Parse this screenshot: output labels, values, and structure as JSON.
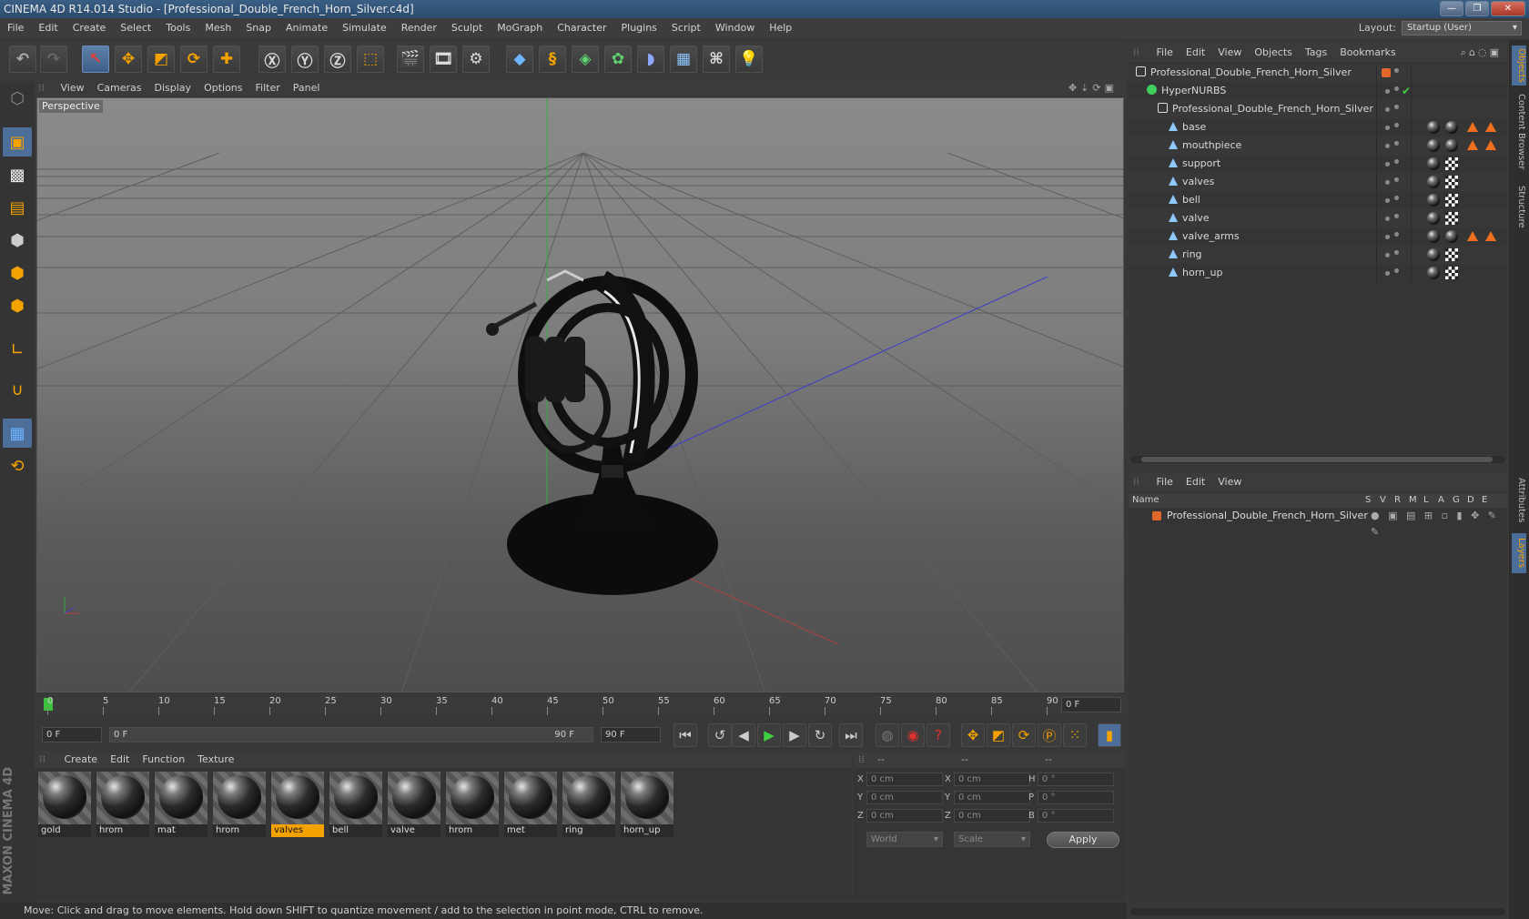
{
  "window": {
    "title": "CINEMA 4D R14.014 Studio - [Professional_Double_French_Horn_Silver.c4d]"
  },
  "menubar": {
    "items": [
      "File",
      "Edit",
      "Create",
      "Select",
      "Tools",
      "Mesh",
      "Snap",
      "Animate",
      "Simulate",
      "Render",
      "Sculpt",
      "MoGraph",
      "Character",
      "Plugins",
      "Script",
      "Window",
      "Help"
    ],
    "layout_label": "Layout:",
    "layout_value": "Startup (User)"
  },
  "viewport": {
    "menu": [
      "View",
      "Cameras",
      "Display",
      "Options",
      "Filter",
      "Panel"
    ],
    "label": "Perspective"
  },
  "timeline": {
    "ticks": [
      "0",
      "5",
      "10",
      "15",
      "20",
      "25",
      "30",
      "35",
      "40",
      "45",
      "50",
      "55",
      "60",
      "65",
      "70",
      "75",
      "80",
      "85",
      "90"
    ],
    "frame_right": "0 F"
  },
  "transport": {
    "start_frame": "0 F",
    "slider_left": "0 F",
    "slider_right": "90 F",
    "end_frame": "90 F"
  },
  "materials": {
    "menu": [
      "Create",
      "Edit",
      "Function",
      "Texture"
    ],
    "items": [
      {
        "name": "gold",
        "selected": false
      },
      {
        "name": "hrom",
        "selected": false
      },
      {
        "name": "mat",
        "selected": false
      },
      {
        "name": "hrom",
        "selected": false
      },
      {
        "name": "valves",
        "selected": true
      },
      {
        "name": "bell",
        "selected": false
      },
      {
        "name": "valve",
        "selected": false
      },
      {
        "name": "hrom",
        "selected": false
      },
      {
        "name": "met",
        "selected": false
      },
      {
        "name": "ring",
        "selected": false
      },
      {
        "name": "horn_up",
        "selected": false
      }
    ]
  },
  "coordinates": {
    "header": [
      "--",
      "--",
      "--"
    ],
    "rows": [
      {
        "l1": "X",
        "v1": "0 cm",
        "l2": "X",
        "v2": "0 cm",
        "l3": "H",
        "v3": "0 °"
      },
      {
        "l1": "Y",
        "v1": "0 cm",
        "l2": "Y",
        "v2": "0 cm",
        "l3": "P",
        "v3": "0 °"
      },
      {
        "l1": "Z",
        "v1": "0 cm",
        "l2": "Z",
        "v2": "0 cm",
        "l3": "B",
        "v3": "0 °"
      }
    ],
    "mode1": "World",
    "mode2": "Scale",
    "apply": "Apply"
  },
  "status": {
    "text": "Move: Click and drag to move elements. Hold down SHIFT to quantize movement / add to the selection in point mode, CTRL to remove."
  },
  "objects": {
    "menu": [
      "File",
      "Edit",
      "View",
      "Objects",
      "Tags",
      "Bookmarks"
    ],
    "rows": [
      {
        "name": "Professional_Double_French_Horn_Silver",
        "kind": "null",
        "indent": 0
      },
      {
        "name": "HyperNURBS",
        "kind": "nurbs",
        "indent": 1
      },
      {
        "name": "Professional_Double_French_Horn_Silver",
        "kind": "null",
        "indent": 2
      },
      {
        "name": "base",
        "kind": "poly",
        "indent": 3
      },
      {
        "name": "mouthpiece",
        "kind": "poly",
        "indent": 3
      },
      {
        "name": "support",
        "kind": "poly",
        "indent": 3
      },
      {
        "name": "valves",
        "kind": "poly",
        "indent": 3
      },
      {
        "name": "bell",
        "kind": "poly",
        "indent": 3
      },
      {
        "name": "valve",
        "kind": "poly",
        "indent": 3
      },
      {
        "name": "valve_arms",
        "kind": "poly",
        "indent": 3
      },
      {
        "name": "ring",
        "kind": "poly",
        "indent": 3
      },
      {
        "name": "horn_up",
        "kind": "poly",
        "indent": 3
      }
    ]
  },
  "layers": {
    "menu": [
      "File",
      "Edit",
      "View"
    ],
    "columns": [
      "Name",
      "S",
      "V",
      "R",
      "M",
      "L",
      "A",
      "G",
      "D",
      "E"
    ],
    "row": "Professional_Double_French_Horn_Silver"
  },
  "right_tabs": [
    "Objects",
    "Content Browser",
    "Structure",
    "Attributes",
    "Layers"
  ],
  "brand": "MAXON CINEMA 4D",
  "colors": {
    "accent": "#f3a200",
    "tag_orange": "#f07020"
  }
}
